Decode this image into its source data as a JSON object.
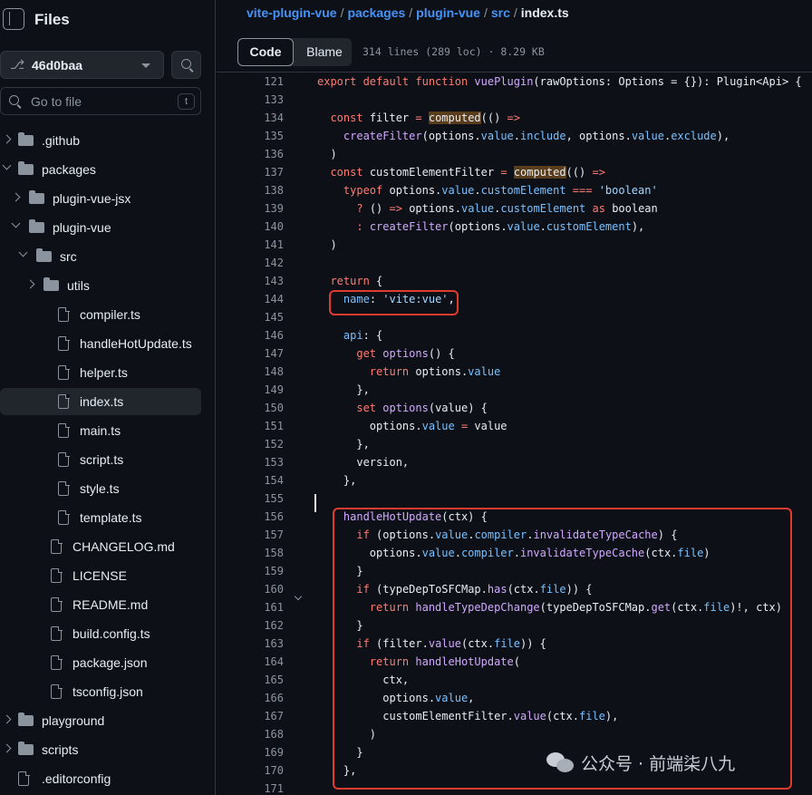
{
  "sidebar": {
    "title": "Files",
    "branch": "46d0baa",
    "goto_placeholder": "Go to file",
    "goto_shortcut": "t",
    "tree": [
      {
        "label": ".github",
        "type": "folder",
        "depth": 0,
        "expanded": false
      },
      {
        "label": "packages",
        "type": "folder",
        "depth": 0,
        "expanded": true
      },
      {
        "label": "plugin-vue-jsx",
        "type": "folder",
        "depth": 1,
        "expanded": false
      },
      {
        "label": "plugin-vue",
        "type": "folder",
        "depth": 1,
        "expanded": true
      },
      {
        "label": "src",
        "type": "folder",
        "depth": 2,
        "expanded": true
      },
      {
        "label": "utils",
        "type": "folder",
        "depth": 3,
        "expanded": false
      },
      {
        "label": "compiler.ts",
        "type": "file",
        "depth": 3
      },
      {
        "label": "handleHotUpdate.ts",
        "type": "file",
        "depth": 3
      },
      {
        "label": "helper.ts",
        "type": "file",
        "depth": 3
      },
      {
        "label": "index.ts",
        "type": "file",
        "depth": 3,
        "selected": true
      },
      {
        "label": "main.ts",
        "type": "file",
        "depth": 3
      },
      {
        "label": "script.ts",
        "type": "file",
        "depth": 3
      },
      {
        "label": "style.ts",
        "type": "file",
        "depth": 3
      },
      {
        "label": "template.ts",
        "type": "file",
        "depth": 3
      },
      {
        "label": "CHANGELOG.md",
        "type": "file",
        "depth": 2
      },
      {
        "label": "LICENSE",
        "type": "file",
        "depth": 2
      },
      {
        "label": "README.md",
        "type": "file",
        "depth": 2
      },
      {
        "label": "build.config.ts",
        "type": "file",
        "depth": 2
      },
      {
        "label": "package.json",
        "type": "file",
        "depth": 2
      },
      {
        "label": "tsconfig.json",
        "type": "file",
        "depth": 2
      },
      {
        "label": "playground",
        "type": "folder",
        "depth": 0,
        "expanded": false
      },
      {
        "label": "scripts",
        "type": "folder",
        "depth": 0,
        "expanded": false
      },
      {
        "label": ".editorconfig",
        "type": "file",
        "depth": 0
      }
    ]
  },
  "breadcrumb": [
    "vite-plugin-vue",
    "packages",
    "plugin-vue",
    "src",
    "index.ts"
  ],
  "toolbar": {
    "code_label": "Code",
    "blame_label": "Blame",
    "file_info": "314 lines (289 loc) · 8.29 KB"
  },
  "code_lines": [
    {
      "n": "121",
      "t": [
        [
          "kw",
          "export default function "
        ],
        [
          "fn",
          "vuePlugin"
        ],
        [
          "",
          "(rawOptions: Options = {}): Plugin<Api> {"
        ]
      ]
    },
    {
      "n": "133",
      "t": []
    },
    {
      "n": "134",
      "t": [
        [
          "",
          "  "
        ],
        [
          "kw",
          "const "
        ],
        [
          "",
          "filter "
        ],
        [
          "kw",
          "= "
        ],
        [
          "hl",
          "computed"
        ],
        [
          "",
          "(() "
        ],
        [
          "kw",
          "=>"
        ]
      ]
    },
    {
      "n": "135",
      "t": [
        [
          "",
          "    "
        ],
        [
          "fn",
          "createFilter"
        ],
        [
          "",
          "(options."
        ],
        [
          "prop",
          "value"
        ],
        [
          "",
          "."
        ],
        [
          "prop",
          "include"
        ],
        [
          "",
          ", options."
        ],
        [
          "prop",
          "value"
        ],
        [
          "",
          "."
        ],
        [
          "prop",
          "exclude"
        ],
        [
          "",
          "),"
        ]
      ]
    },
    {
      "n": "136",
      "t": [
        [
          "",
          "  )"
        ]
      ]
    },
    {
      "n": "137",
      "t": [
        [
          "",
          "  "
        ],
        [
          "kw",
          "const "
        ],
        [
          "",
          "customElementFilter "
        ],
        [
          "kw",
          "= "
        ],
        [
          "hl",
          "computed"
        ],
        [
          "",
          "(() "
        ],
        [
          "kw",
          "=>"
        ]
      ]
    },
    {
      "n": "138",
      "t": [
        [
          "",
          "    "
        ],
        [
          "kw",
          "typeof "
        ],
        [
          "",
          "options."
        ],
        [
          "prop",
          "value"
        ],
        [
          "",
          "."
        ],
        [
          "prop",
          "customElement"
        ],
        [
          "kw",
          " === "
        ],
        [
          "str",
          "'boolean'"
        ]
      ]
    },
    {
      "n": "139",
      "t": [
        [
          "",
          "      "
        ],
        [
          "kw",
          "? "
        ],
        [
          "",
          "() "
        ],
        [
          "kw",
          "=> "
        ],
        [
          "",
          "options."
        ],
        [
          "prop",
          "value"
        ],
        [
          "",
          "."
        ],
        [
          "prop",
          "customElement "
        ],
        [
          "kw",
          "as "
        ],
        [
          "",
          "boolean"
        ]
      ]
    },
    {
      "n": "140",
      "t": [
        [
          "",
          "      "
        ],
        [
          "kw",
          ": "
        ],
        [
          "fn",
          "createFilter"
        ],
        [
          "",
          "(options."
        ],
        [
          "prop",
          "value"
        ],
        [
          "",
          "."
        ],
        [
          "prop",
          "customElement"
        ],
        [
          "",
          "),"
        ]
      ]
    },
    {
      "n": "141",
      "t": [
        [
          "",
          "  )"
        ]
      ]
    },
    {
      "n": "142",
      "t": []
    },
    {
      "n": "143",
      "t": [
        [
          "",
          "  "
        ],
        [
          "kw",
          "return "
        ],
        [
          "",
          "{"
        ]
      ]
    },
    {
      "n": "144",
      "t": [
        [
          "",
          "    "
        ],
        [
          "prop",
          "name"
        ],
        [
          "",
          ": "
        ],
        [
          "str",
          "'vite:vue'"
        ],
        [
          "",
          ","
        ]
      ]
    },
    {
      "n": "145",
      "t": []
    },
    {
      "n": "146",
      "t": [
        [
          "",
          "    "
        ],
        [
          "prop",
          "api"
        ],
        [
          "",
          ": {"
        ]
      ]
    },
    {
      "n": "147",
      "t": [
        [
          "",
          "      "
        ],
        [
          "kw",
          "get "
        ],
        [
          "fn",
          "options"
        ],
        [
          "",
          "() {"
        ]
      ]
    },
    {
      "n": "148",
      "t": [
        [
          "",
          "        "
        ],
        [
          "kw",
          "return "
        ],
        [
          "",
          "options."
        ],
        [
          "prop",
          "value"
        ]
      ]
    },
    {
      "n": "149",
      "t": [
        [
          "",
          "      },"
        ]
      ]
    },
    {
      "n": "150",
      "t": [
        [
          "",
          "      "
        ],
        [
          "kw",
          "set "
        ],
        [
          "fn",
          "options"
        ],
        [
          "",
          "(value) {"
        ]
      ]
    },
    {
      "n": "151",
      "t": [
        [
          "",
          "        options."
        ],
        [
          "prop",
          "value "
        ],
        [
          "kw",
          "= "
        ],
        [
          "",
          "value"
        ]
      ]
    },
    {
      "n": "152",
      "t": [
        [
          "",
          "      },"
        ]
      ]
    },
    {
      "n": "153",
      "t": [
        [
          "",
          "      version,"
        ]
      ]
    },
    {
      "n": "154",
      "t": [
        [
          "",
          "    },"
        ]
      ]
    },
    {
      "n": "155",
      "t": []
    },
    {
      "n": "156",
      "t": [
        [
          "",
          "    "
        ],
        [
          "fn",
          "handleHotUpdate"
        ],
        [
          "",
          "(ctx) {"
        ]
      ]
    },
    {
      "n": "157",
      "t": [
        [
          "",
          "      "
        ],
        [
          "kw",
          "if "
        ],
        [
          "",
          "(options."
        ],
        [
          "prop",
          "value"
        ],
        [
          "",
          "."
        ],
        [
          "prop",
          "compiler"
        ],
        [
          "",
          "."
        ],
        [
          "fn",
          "invalidateTypeCache"
        ],
        [
          "",
          ") {"
        ]
      ]
    },
    {
      "n": "158",
      "t": [
        [
          "",
          "        options."
        ],
        [
          "prop",
          "value"
        ],
        [
          "",
          "."
        ],
        [
          "prop",
          "compiler"
        ],
        [
          "",
          "."
        ],
        [
          "fn",
          "invalidateTypeCache"
        ],
        [
          "",
          "(ctx."
        ],
        [
          "prop",
          "file"
        ],
        [
          "",
          ")"
        ]
      ]
    },
    {
      "n": "159",
      "t": [
        [
          "",
          "      }"
        ]
      ]
    },
    {
      "n": "160",
      "t": [
        [
          "",
          "      "
        ],
        [
          "kw",
          "if "
        ],
        [
          "",
          "(typeDepToSFCMap."
        ],
        [
          "fn",
          "has"
        ],
        [
          "",
          "(ctx."
        ],
        [
          "prop",
          "file"
        ],
        [
          "",
          ")) {"
        ]
      ]
    },
    {
      "n": "161",
      "t": [
        [
          "",
          "        "
        ],
        [
          "kw",
          "return "
        ],
        [
          "fn",
          "handleTypeDepChange"
        ],
        [
          "",
          "(typeDepToSFCMap."
        ],
        [
          "fn",
          "get"
        ],
        [
          "",
          "(ctx."
        ],
        [
          "prop",
          "file"
        ],
        [
          "",
          ")!, ctx)"
        ]
      ]
    },
    {
      "n": "162",
      "t": [
        [
          "",
          "      }"
        ]
      ]
    },
    {
      "n": "163",
      "t": [
        [
          "",
          "      "
        ],
        [
          "kw",
          "if "
        ],
        [
          "",
          "(filter."
        ],
        [
          "fn",
          "value"
        ],
        [
          "",
          "(ctx."
        ],
        [
          "prop",
          "file"
        ],
        [
          "",
          ")) {"
        ]
      ]
    },
    {
      "n": "164",
      "t": [
        [
          "",
          "        "
        ],
        [
          "kw",
          "return "
        ],
        [
          "fn",
          "handleHotUpdate"
        ],
        [
          "",
          "("
        ]
      ]
    },
    {
      "n": "165",
      "t": [
        [
          "",
          "          ctx,"
        ]
      ]
    },
    {
      "n": "166",
      "t": [
        [
          "",
          "          options."
        ],
        [
          "prop",
          "value"
        ],
        [
          "",
          ","
        ]
      ]
    },
    {
      "n": "167",
      "t": [
        [
          "",
          "          customElementFilter."
        ],
        [
          "fn",
          "value"
        ],
        [
          "",
          "(ctx."
        ],
        [
          "prop",
          "file"
        ],
        [
          "",
          "),"
        ]
      ]
    },
    {
      "n": "168",
      "t": [
        [
          "",
          "        )"
        ]
      ]
    },
    {
      "n": "169",
      "t": [
        [
          "",
          "      }"
        ]
      ]
    },
    {
      "n": "170",
      "t": [
        [
          "",
          "    },"
        ]
      ]
    },
    {
      "n": "171",
      "t": []
    }
  ],
  "watermark": "公众号 · 前端柒八九",
  "colors": {
    "background": "#0d1117",
    "link": "#4493f8",
    "keyword": "#ff7b72",
    "function": "#d2a8ff",
    "property": "#79c0ff",
    "string": "#a5d6ff",
    "annotation_box": "#e03b2f"
  }
}
